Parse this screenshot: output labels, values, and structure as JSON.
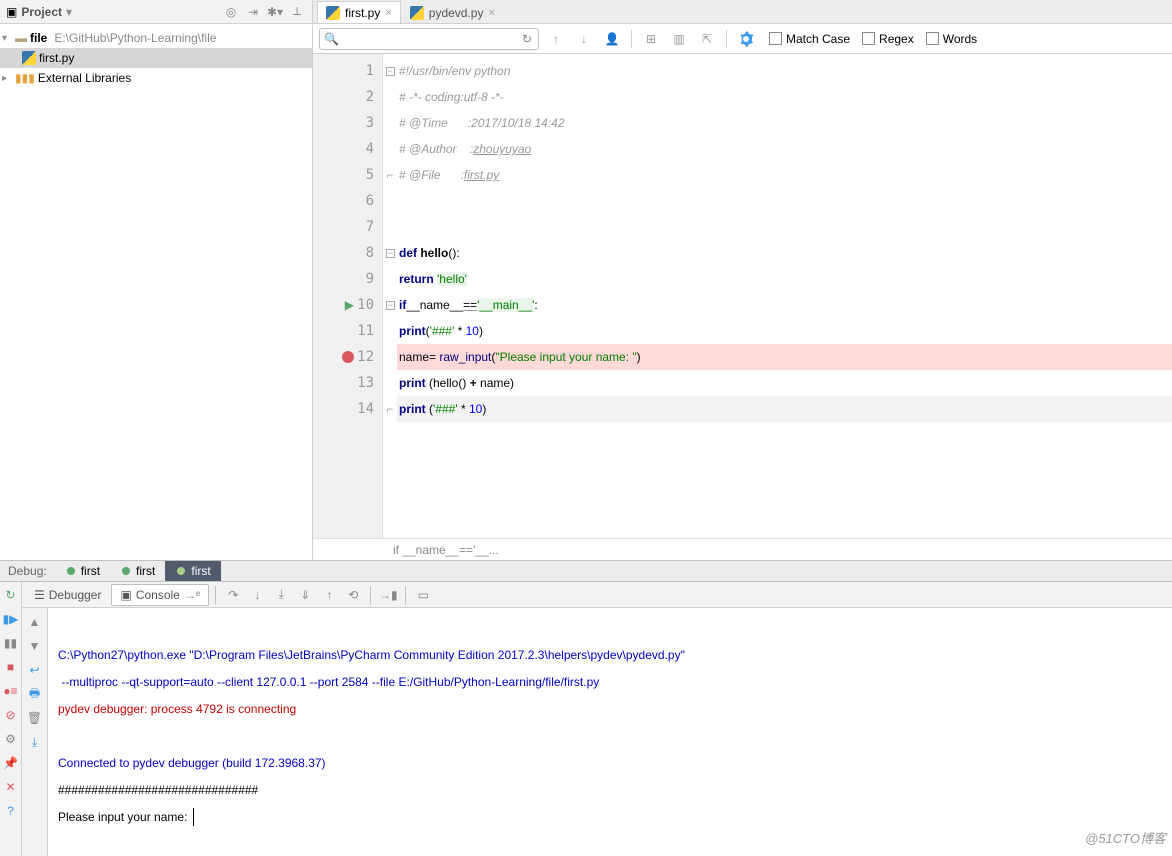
{
  "project_panel": {
    "title": "Project",
    "root": {
      "label": "file",
      "path": "E:\\GitHub\\Python-Learning\\file"
    },
    "file": "first.py",
    "libs": "External Libraries"
  },
  "editor_tabs": [
    {
      "label": "first.py",
      "active": true
    },
    {
      "label": "pydevd.py",
      "active": false
    }
  ],
  "search": {
    "match_case": "Match Case",
    "regex": "Regex",
    "words": "Words"
  },
  "code": {
    "l1_a": "#!/usr/bin/env python",
    "l2": "# -*- coding:utf-8 -*-",
    "l3": "# @Time      :2017/10/18 14:42",
    "l4_a": "# @Author    :",
    "l4_b": "zhouyuyao",
    "l5_a": "# @File      :",
    "l5_b": "first.py",
    "l8_def": "def ",
    "l8_fn": "hello",
    "l8_rest": "():",
    "l9_ret": "return ",
    "l9_str": "'hello'",
    "l10_if": "if",
    "l10_name": "__name__",
    "l10_eq": "==",
    "l10_main": "'__main__'",
    "l10_colon": ":",
    "l11_print": "print",
    "l11_open": "(",
    "l11_str": "'###'",
    "l11_mul": " * ",
    "l11_num": "10",
    "l11_close": ")",
    "l12_a": "name= ",
    "l12_fn": "raw_input",
    "l12_open": "(",
    "l12_str": "\"Please input your name: \"",
    "l12_close": ")",
    "l13_print": "print ",
    "l13_rest1": "(hello() ",
    "l13_plus": "+",
    "l13_rest2": " name)",
    "l14_print": "print ",
    "l14_open": "(",
    "l14_str": "'###'",
    "l14_mul": " * ",
    "l14_num": "10",
    "l14_close": ")"
  },
  "breadcrumb": "if __name__=='__...",
  "debug_tabs": {
    "label": "Debug:",
    "t1": "first",
    "t2": "first",
    "t3": "first"
  },
  "debug_toolbar": {
    "debugger": "Debugger",
    "console": "Console"
  },
  "console": {
    "line1": "C:\\Python27\\python.exe \"D:\\Program Files\\JetBrains\\PyCharm Community Edition 2017.2.3\\helpers\\pydev\\pydevd.py\"",
    "line2": " --multiproc --qt-support=auto --client 127.0.0.1 --port 2584 --file E:/GitHub/Python-Learning/file/first.py",
    "line3": "pydev debugger: process 4792 is connecting",
    "line4": "",
    "line5": "Connected to pydev debugger (build 172.3968.37)",
    "line6": "##############################",
    "line7": "Please input your name: "
  },
  "watermark": "@51CTO博客"
}
